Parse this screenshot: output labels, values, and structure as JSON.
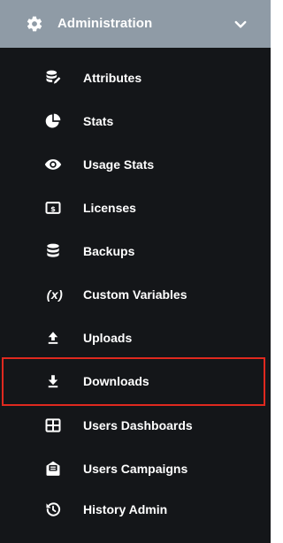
{
  "section": {
    "title": "Administration",
    "icon": "gear-icon",
    "toggle_icon": "chevron-down-icon"
  },
  "menu": {
    "items": [
      {
        "label": "Attributes",
        "icon": "database-edit-icon"
      },
      {
        "label": "Stats",
        "icon": "pie-chart-icon"
      },
      {
        "label": "Usage Stats",
        "icon": "eye-icon"
      },
      {
        "label": "Licenses",
        "icon": "license-dollar-icon"
      },
      {
        "label": "Backups",
        "icon": "database-icon"
      },
      {
        "label": "Custom Variables",
        "icon": "variable-icon",
        "glyph": "(x)"
      },
      {
        "label": "Uploads",
        "icon": "upload-icon"
      },
      {
        "label": "Downloads",
        "icon": "download-icon",
        "highlighted": true
      },
      {
        "label": "Users Dashboards",
        "icon": "dashboard-grid-icon"
      },
      {
        "label": "Users Campaigns",
        "icon": "campaign-mail-icon"
      },
      {
        "label": "History Admin",
        "icon": "history-icon"
      }
    ]
  },
  "colors": {
    "sidebar_bg": "#141619",
    "header_bg": "#8f9ba6",
    "text": "#ffffff",
    "highlight_border": "#e0291f"
  }
}
